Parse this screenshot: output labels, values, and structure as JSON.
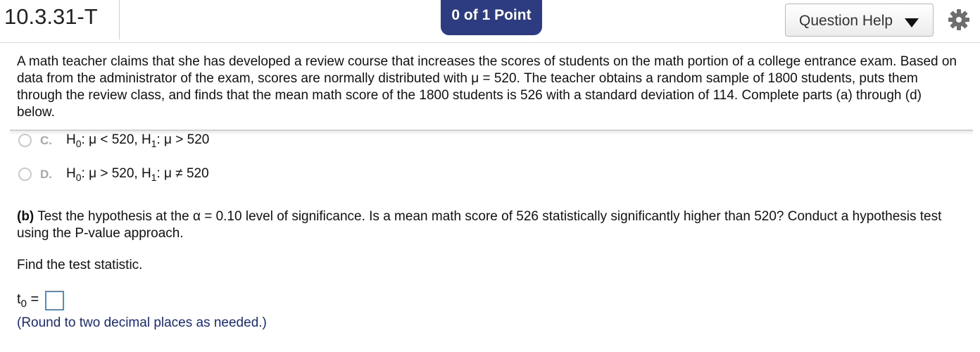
{
  "header": {
    "question_id": "10.3.31-T",
    "points": "0 of 1 Point",
    "help_label": "Question Help",
    "help_icon": "caret-down-icon",
    "settings_icon": "gear-icon"
  },
  "prompt": "A math teacher claims that she has developed a review course that increases the scores of students on the math portion of a college entrance exam. Based on data from the administrator of the exam, scores are normally distributed with μ = 520. The teacher obtains a random sample of 1800 students, puts them through the review class, and finds that the mean math score of the 1800 students is 526 with a standard deviation of 114. Complete parts (a) through (d) below.",
  "options": [
    {
      "letter": "C.",
      "h0_pre": "H",
      "h0_sub": "0",
      "h0_post": ": μ < 520, H",
      "h1_sub": "1",
      "h1_post": ": μ > 520"
    },
    {
      "letter": "D.",
      "h0_pre": "H",
      "h0_sub": "0",
      "h0_post": ": μ > 520, H",
      "h1_sub": "1",
      "h1_post": ": μ ≠ 520"
    }
  ],
  "part_b": {
    "label": "(b)",
    "text": " Test the hypothesis at the α = 0.10 level of significance. Is a mean math score of 526 statistically significantly higher than 520? Conduct a hypothesis test using the P-value approach."
  },
  "find_text": "Find the test statistic.",
  "answer": {
    "var": "t",
    "var_sub": "0",
    "equals": "=",
    "value": "",
    "note": "(Round to two decimal places as needed.)"
  }
}
